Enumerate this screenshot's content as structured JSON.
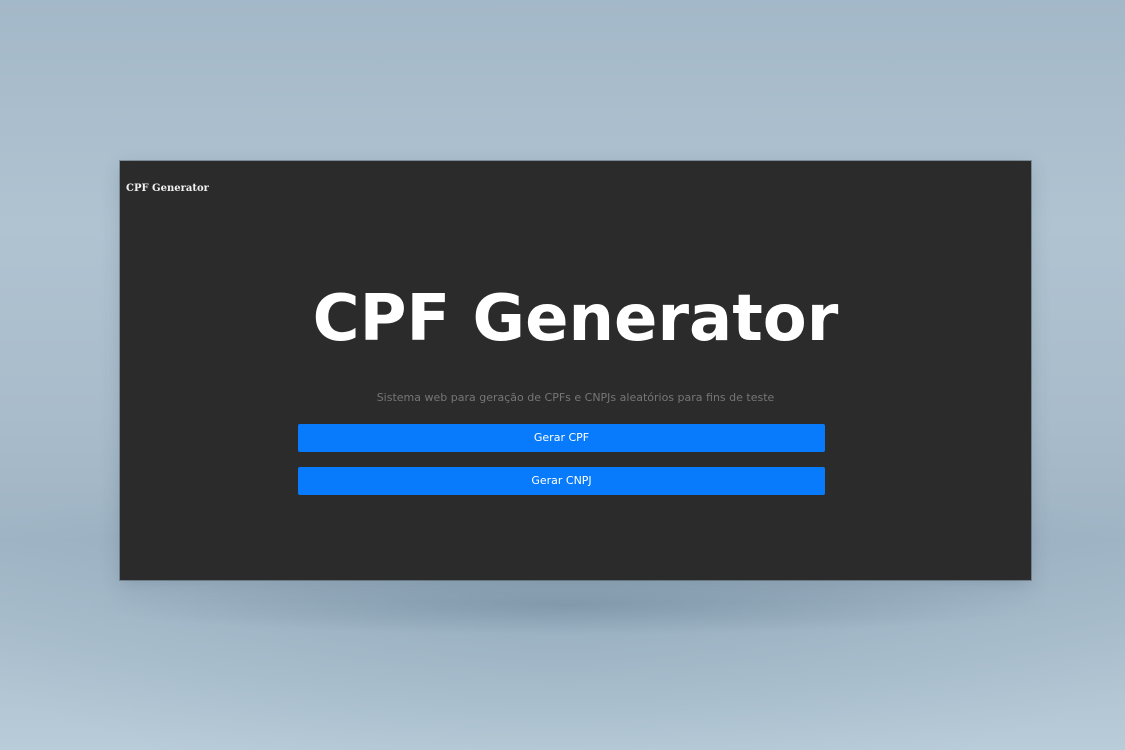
{
  "navbar": {
    "brand": "CPF Generator"
  },
  "hero": {
    "title": "CPF Generator",
    "subtitle": "Sistema web para geração de CPFs e CNPJs aleatórios para fins de teste"
  },
  "actions": {
    "generate_cpf_label": "Gerar CPF",
    "generate_cnpj_label": "Gerar CNPJ"
  },
  "colors": {
    "page_background": "#a9bccb",
    "app_background": "#2b2b2b",
    "button_primary": "#087bfc",
    "title_text": "#ffffff",
    "subtitle_text": "#767676"
  }
}
